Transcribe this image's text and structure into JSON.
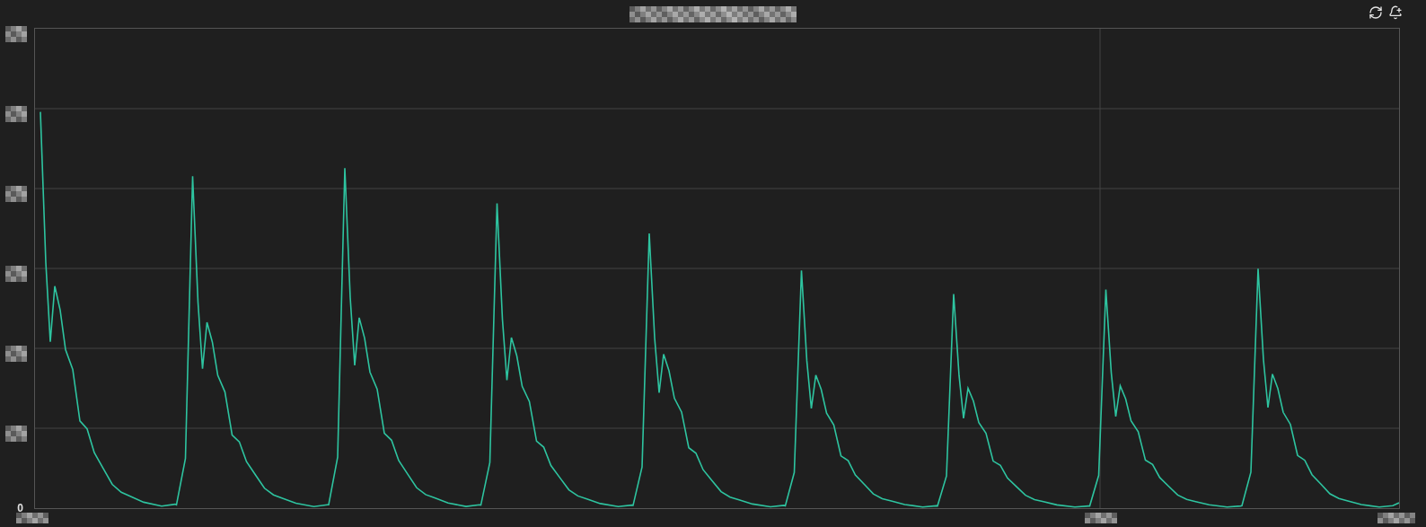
{
  "chart": {
    "y_axis_labels": [
      "0"
    ]
  }
}
